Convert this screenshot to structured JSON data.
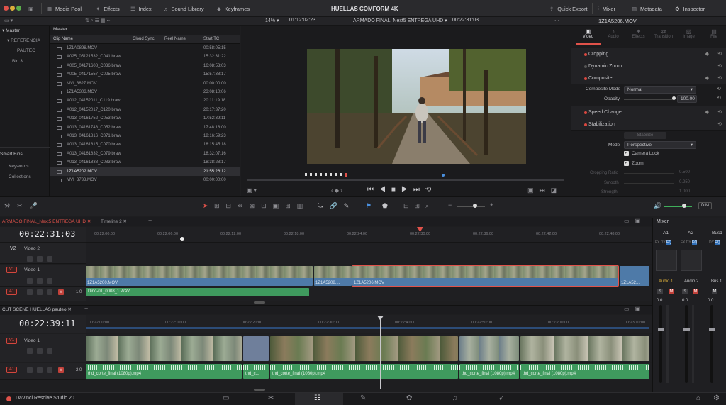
{
  "topbar": {
    "media_pool": "Media Pool",
    "effects": "Effects",
    "index": "Index",
    "sound_library": "Sound Library",
    "keyframes": "Keyframes",
    "project_title": "HUELLAS COMFORM 4K",
    "quick_export": "Quick Export",
    "mixer": "Mixer",
    "metadata": "Metadata",
    "inspector": "Inspector"
  },
  "row2": {
    "zoom": "14%",
    "source_tc": "01:12:02:23",
    "timeline_name": "ARMADO FINAL_Next5 ENTREGA UHD",
    "record_tc": "00:22:31:03",
    "inspector_clip": "1Z1A5206.MOV"
  },
  "bins": {
    "master": "Master",
    "items": [
      "REFERENCIA",
      "PAUTEO",
      "Bin 3"
    ],
    "smart_bins": "Smart Bins",
    "smart_items": [
      "Keywords",
      "Collections"
    ]
  },
  "media_pool": {
    "path": "Master",
    "columns": [
      "Clip Name",
      "Cloud Sync",
      "Reel Name",
      "Start TC"
    ],
    "clips": [
      {
        "name": "1Z1A0898.MOV",
        "tc": "00:58:05:15"
      },
      {
        "name": "A025_05121532_C041.braw",
        "tc": "15:32:31:22"
      },
      {
        "name": "A005_04171608_C036.braw",
        "tc": "16:08:53:03"
      },
      {
        "name": "A005_04171557_C025.braw",
        "tc": "15:57:38:17"
      },
      {
        "name": "MVI_3827.MOV",
        "tc": "00:00:00:00"
      },
      {
        "name": "1Z1A5303.MOV",
        "tc": "23:08:10:06"
      },
      {
        "name": "A012_04152011_C119.braw",
        "tc": "20:11:19:18"
      },
      {
        "name": "A012_04152017_C120.braw",
        "tc": "20:17:37:20"
      },
      {
        "name": "A013_04161752_C053.braw",
        "tc": "17:52:39:11"
      },
      {
        "name": "A013_04161748_C052.braw",
        "tc": "17:48:18:00"
      },
      {
        "name": "A013_04161816_C071.braw",
        "tc": "18:16:59:23"
      },
      {
        "name": "A013_04161815_C070.braw",
        "tc": "18:15:45:18"
      },
      {
        "name": "A013_04161832_C079.braw",
        "tc": "18:32:07:16"
      },
      {
        "name": "A013_04161838_C083.braw",
        "tc": "18:38:28:17"
      },
      {
        "name": "1Z1A5202.MOV",
        "tc": "21:55:26:12"
      },
      {
        "name": "MVI_3733.MOV",
        "tc": "00:00:00:00"
      }
    ]
  },
  "inspector": {
    "tabs": [
      "Video",
      "Audio",
      "Effects",
      "Transition",
      "Image",
      "File"
    ],
    "cropping": "Cropping",
    "dynamic_zoom": "Dynamic Zoom",
    "composite": "Composite",
    "composite_mode_label": "Composite Mode",
    "composite_mode": "Normal",
    "opacity_label": "Opacity",
    "opacity": "100.00",
    "speed_change": "Speed Change",
    "stabilization": "Stabilization",
    "stabilize_btn": "Stabilize",
    "mode_label": "Mode",
    "mode": "Perspective",
    "camera_lock": "Camera Lock",
    "zoom": "Zoom",
    "cropping_ratio": "Cropping Ratio",
    "cropping_ratio_val": "0.500",
    "smooth": "Smooth",
    "smooth_val": "0.250",
    "strength": "Strength",
    "strength_val": "1.000"
  },
  "toolbar": {
    "dim": "DIM"
  },
  "timeline1": {
    "tab": "ARMADO FINAL_Next5 ENTREGA UHD",
    "tab2": "Timeline 2",
    "timecode": "00:22:31:03",
    "ruler": [
      "00:22:00:00",
      "00:22:06:00",
      "00:22:12:00",
      "00:22:18:00",
      "00:22:24:00",
      "00:22:30:00",
      "00:22:36:00",
      "00:22:42:00",
      "00:22:48:00"
    ],
    "v2": "Video 2",
    "v1": "Video 1",
    "a1_num": "1.0",
    "clips": [
      "1Z1A5200.MOV",
      "1Z1A5208....",
      "1Z1A5206.MOV",
      "1Z1A52..."
    ],
    "audio_clip": "Dino-01_0008_1.WAV"
  },
  "timeline2": {
    "tab": "CUT SCENE HUELLAS pauteo",
    "timecode": "00:22:39:11",
    "ruler": [
      "00:22:00:00",
      "00:22:10:00",
      "00:22:20:00",
      "00:22:30:00",
      "00:22:40:00",
      "00:22:50:00",
      "00:23:00:00",
      "00:23:10:00"
    ],
    "v1": "Video 1",
    "a1_num": "2.0",
    "audio_clips": [
      "thd_corte_final (1080p).mp4",
      "thd_c...",
      "thd_corte_final (1080p).mp4",
      "thd_corte_final (1080p).mp4",
      "thd_corte_final (1080p).mp4"
    ]
  },
  "mixer": {
    "title": "Mixer",
    "channels": [
      "A1",
      "A2",
      "Bus1"
    ],
    "labels": [
      "Audio 1",
      "Audio 2",
      "Bus 1"
    ],
    "values": [
      "0.0",
      "0.0",
      "0.0"
    ]
  },
  "bottom": {
    "app_name": "DaVinci Resolve Studio 20"
  }
}
